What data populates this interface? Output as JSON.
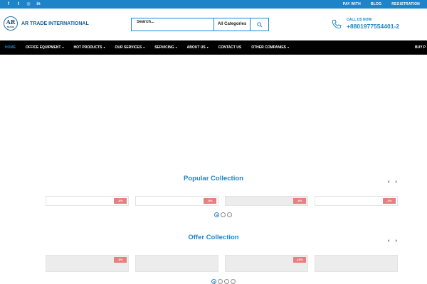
{
  "topbar": {
    "social": [
      {
        "icon": "facebook-icon",
        "glyph": "f"
      },
      {
        "icon": "twitter-icon",
        "glyph": "t"
      },
      {
        "icon": "instagram-icon",
        "glyph": "◎"
      },
      {
        "icon": "linkedin-icon",
        "glyph": "in"
      }
    ],
    "links": [
      "PAY WITH",
      "BLOG",
      "REGISTRATION"
    ]
  },
  "header": {
    "logo_mark": "AR",
    "logo_sub": "TRADE",
    "brand_name": "AR TRADE INTERNATIONAL",
    "search_placeholder": "Search...",
    "category_selected": "All Categories",
    "call_label": "CALL US NOW",
    "call_number": "+8801977554401-2"
  },
  "nav": {
    "items": [
      {
        "label": "HOME",
        "caret": false,
        "active": true
      },
      {
        "label": "OFFICE EQUIPMENT",
        "caret": true,
        "active": false
      },
      {
        "label": "HOT PRODUCTS",
        "caret": true,
        "active": false
      },
      {
        "label": "OUR SERVICES",
        "caret": true,
        "active": false
      },
      {
        "label": "SERVICING",
        "caret": true,
        "active": false
      },
      {
        "label": "ABOUT US",
        "caret": true,
        "active": false
      },
      {
        "label": "CONTACT US",
        "caret": false,
        "active": false
      },
      {
        "label": "OTHER COMPANIES",
        "caret": true,
        "active": false
      }
    ],
    "buy_label": "BUY P"
  },
  "popular": {
    "title": "Popular Collection",
    "tags": [
      "-6%",
      "-8%",
      "-6%",
      "-3%"
    ],
    "dots": 3,
    "active_dot": 0
  },
  "offer": {
    "title": "Offer Collection",
    "tags": [
      "-6%",
      "",
      "-15%",
      ""
    ],
    "dots": 4,
    "active_dot": 0
  },
  "colors": {
    "brand_blue": "#1e84c9",
    "nav_bg": "#000000",
    "discount_tag": "#e77f7f"
  }
}
